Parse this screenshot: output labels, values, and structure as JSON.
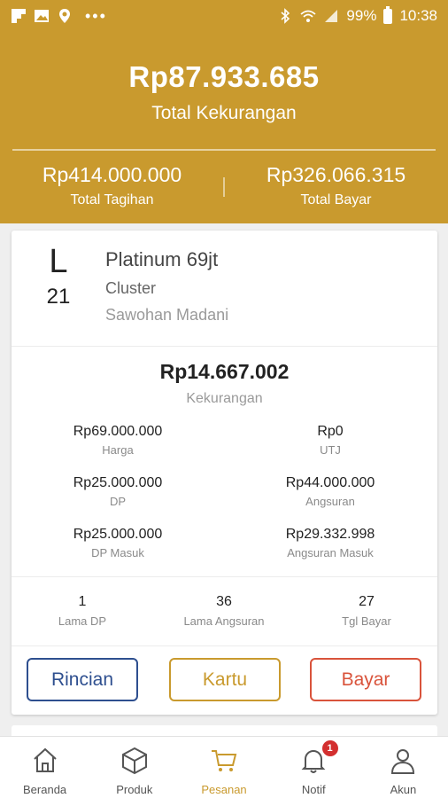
{
  "statusbar": {
    "battery": "99%",
    "time": "10:38",
    "left_icons": [
      "flipboard-icon",
      "image-icon",
      "location-icon"
    ],
    "right_icons": [
      "bluetooth-icon",
      "wifi-icon",
      "signal-icon",
      "battery-icon"
    ]
  },
  "summary": {
    "total_kekurangan_value": "Rp87.933.685",
    "total_kekurangan_label": "Total Kekurangan",
    "total_tagihan_value": "Rp414.000.000",
    "total_tagihan_label": "Total Tagihan",
    "total_bayar_value": "Rp326.066.315",
    "total_bayar_label": "Total Bayar"
  },
  "order": {
    "unit_block": "L",
    "unit_number": "21",
    "product_name": "Platinum 69jt",
    "product_type": "Cluster",
    "location": "Sawohan Madani",
    "kekurangan_value": "Rp14.667.002",
    "kekurangan_label": "Kekurangan",
    "details": [
      {
        "left_value": "Rp69.000.000",
        "left_label": "Harga",
        "right_value": "Rp0",
        "right_label": "UTJ"
      },
      {
        "left_value": "Rp25.000.000",
        "left_label": "DP",
        "right_value": "Rp44.000.000",
        "right_label": "Angsuran"
      },
      {
        "left_value": "Rp25.000.000",
        "left_label": "DP Masuk",
        "right_value": "Rp29.332.998",
        "right_label": "Angsuran Masuk"
      }
    ],
    "stats": [
      {
        "value": "1",
        "label": "Lama DP"
      },
      {
        "value": "36",
        "label": "Lama Angsuran"
      },
      {
        "value": "27",
        "label": "Tgl Bayar"
      }
    ],
    "buttons": {
      "rincian": "Rincian",
      "kartu": "Kartu",
      "bayar": "Bayar"
    }
  },
  "nav": {
    "items": [
      {
        "label": "Beranda",
        "icon": "home-icon"
      },
      {
        "label": "Produk",
        "icon": "box-icon"
      },
      {
        "label": "Pesanan",
        "icon": "cart-icon",
        "active": true
      },
      {
        "label": "Notif",
        "icon": "bell-icon",
        "badge": "1"
      },
      {
        "label": "Akun",
        "icon": "user-icon"
      }
    ]
  },
  "colors": {
    "primary_gold": "#c99a2e",
    "rincian_blue": "#2e4f8f",
    "bayar_red": "#d9533b",
    "badge_red": "#d32f2f"
  }
}
